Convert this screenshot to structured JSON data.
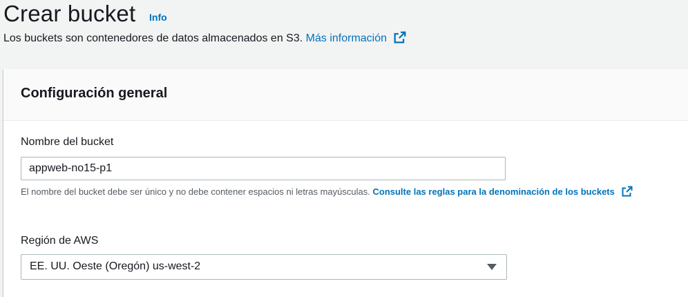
{
  "header": {
    "title": "Crear bucket",
    "info_label": "Info",
    "description": "Los buckets son contenedores de datos almacenados en S3.",
    "more_info_link": "Más información"
  },
  "general_config": {
    "title": "Configuración general",
    "bucket_name": {
      "label": "Nombre del bucket",
      "value": "appweb-no15-p1",
      "hint": "El nombre del bucket debe ser único y no debe contener espacios ni letras mayúsculas.",
      "rules_link": "Consulte las reglas para la denominación de los buckets"
    },
    "region": {
      "label": "Región de AWS",
      "selected": "EE. UU. Oeste (Oregón) us-west-2"
    }
  },
  "colors": {
    "link": "#0073bb",
    "text": "#16191f",
    "muted": "#545b64",
    "background": "#f2f3f3"
  },
  "icons": [
    "external-link-icon",
    "caret-down-icon"
  ]
}
